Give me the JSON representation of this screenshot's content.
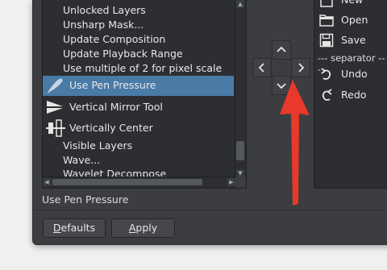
{
  "actions_list": {
    "items": [
      {
        "label": "Unlocked Layers"
      },
      {
        "label": "Unsharp Mask..."
      },
      {
        "label": "Update Composition"
      },
      {
        "label": "Update Playback Range"
      },
      {
        "label": "Use multiple of 2 for pixel scale"
      },
      {
        "label": "Use Pen Pressure",
        "icon": "pen-pressure-icon",
        "selected": true
      },
      {
        "label": "Vertical Mirror Tool",
        "icon": "vertical-mirror-icon"
      },
      {
        "label": "Vertically Center",
        "icon": "vertically-center-icon"
      },
      {
        "label": "Visible Layers"
      },
      {
        "label": "Wave..."
      },
      {
        "label": "Wavelet Decompose"
      }
    ]
  },
  "description": "Use Pen Pressure",
  "move_buttons": {
    "up_icon": "chevron-up-icon",
    "down_icon": "chevron-down-icon",
    "left_icon": "chevron-left-icon",
    "right_icon": "chevron-right-icon"
  },
  "toolbar_list": {
    "items": [
      {
        "label": "New",
        "icon": "new-file-icon"
      },
      {
        "label": "Open",
        "icon": "folder-icon"
      },
      {
        "label": "Save",
        "icon": "save-icon"
      },
      {
        "label": "--- separator ---",
        "type": "separator"
      },
      {
        "label": "Undo",
        "icon": "undo-icon"
      },
      {
        "label": "Redo",
        "icon": "redo-icon"
      }
    ]
  },
  "buttons": {
    "defaults_prefix": "D",
    "defaults_rest": "efaults",
    "apply_prefix": "A",
    "apply_rest": "pply"
  },
  "annotation_color": "#e8392b",
  "selection_color": "#4a7aa6"
}
